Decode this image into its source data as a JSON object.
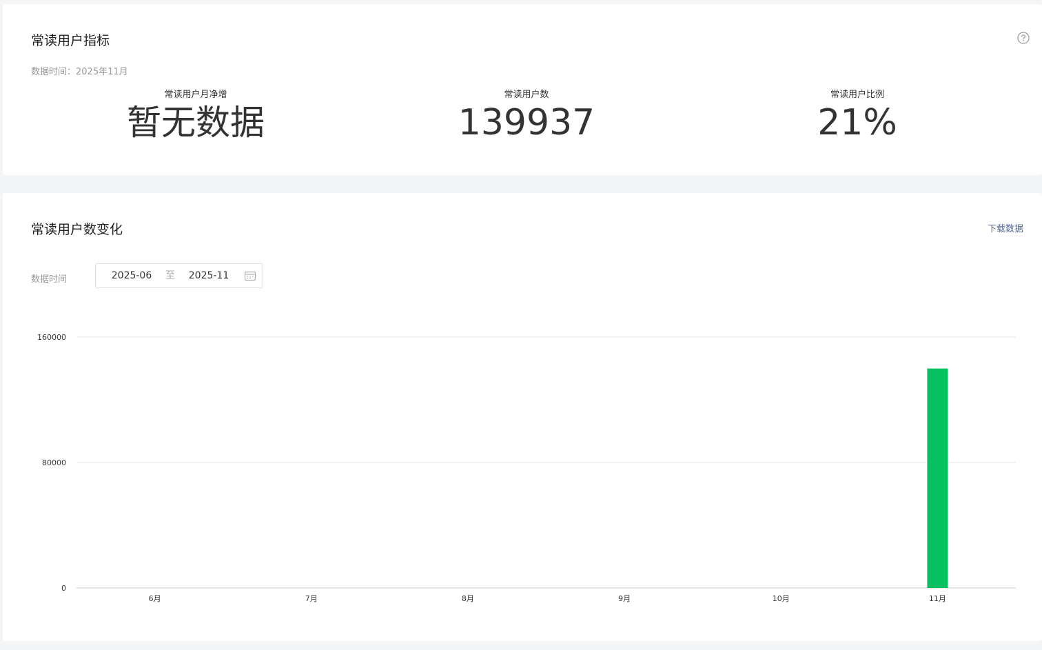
{
  "metrics_card": {
    "title": "常读用户指标",
    "data_time": "数据时间：2025年11月",
    "help_icon": "question-circle-icon",
    "metrics": [
      {
        "label": "常读用户月净增",
        "value": "暂无数据"
      },
      {
        "label": "常读用户数",
        "value": "139937"
      },
      {
        "label": "常读用户比例",
        "value": "21%"
      }
    ]
  },
  "trend_card": {
    "title": "常读用户数变化",
    "download_label": "下载数据",
    "range": {
      "label": "数据时间",
      "start": "2025-06",
      "separator": "至",
      "end": "2025-11",
      "calendar_icon": "calendar-icon"
    }
  },
  "colors": {
    "bar": "#07c160",
    "link": "#576b95",
    "grid": "#e8e8e8"
  },
  "chart_data": {
    "type": "bar",
    "categories": [
      "6月",
      "7月",
      "8月",
      "9月",
      "10月",
      "11月"
    ],
    "values": [
      null,
      null,
      null,
      null,
      null,
      139937
    ],
    "ylim": [
      0,
      160000
    ],
    "yticks": [
      "0",
      "80000",
      "160000"
    ],
    "grid": true,
    "legend": "none"
  }
}
